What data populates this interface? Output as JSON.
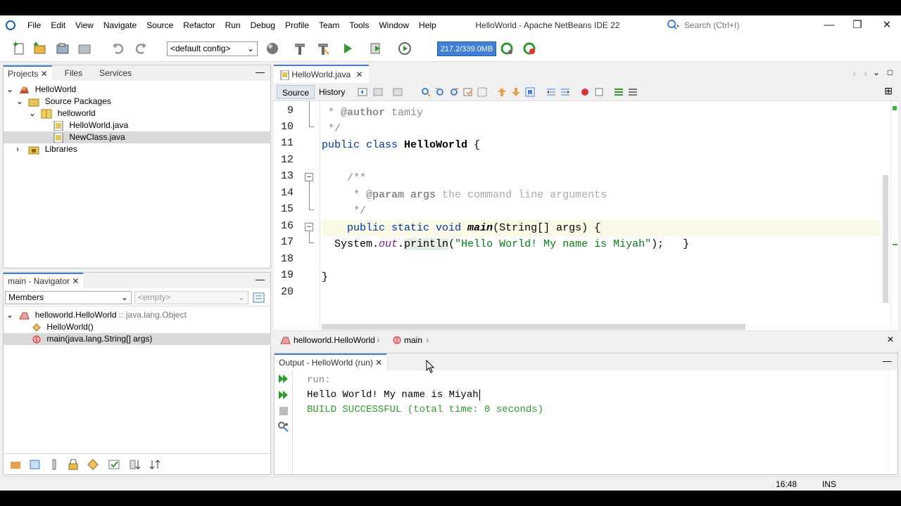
{
  "window": {
    "title": "HelloWorld - Apache NetBeans IDE 22"
  },
  "menu": [
    "File",
    "Edit",
    "View",
    "Navigate",
    "Source",
    "Refactor",
    "Run",
    "Debug",
    "Profile",
    "Team",
    "Tools",
    "Window",
    "Help"
  ],
  "search": {
    "placeholder": "Search (Ctrl+I)"
  },
  "toolbar": {
    "config": "<default config>",
    "memory": "217.2/339.0MB"
  },
  "projects": {
    "tabs": [
      "Projects",
      "Files",
      "Services"
    ],
    "tree": [
      {
        "label": "HelloWorld"
      },
      {
        "label": "Source Packages"
      },
      {
        "label": "helloworld"
      },
      {
        "label": "HelloWorld.java"
      },
      {
        "label": "NewClass.java"
      },
      {
        "label": "Libraries"
      }
    ]
  },
  "navigator": {
    "title": "main - Navigator",
    "filter": "Members",
    "filter2": "<empty>",
    "items": [
      {
        "label": "helloworld.HelloWorld",
        "suffix": ":: java.lang.Object"
      },
      {
        "label": "HelloWorld()"
      },
      {
        "label": "main(java.lang.String[] args)"
      }
    ]
  },
  "editor": {
    "tab": "HelloWorld.java",
    "modes": [
      "Source",
      "History"
    ],
    "lines": [
      {
        "n": "9"
      },
      {
        "n": "10"
      },
      {
        "n": "11"
      },
      {
        "n": "12"
      },
      {
        "n": "13"
      },
      {
        "n": "14"
      },
      {
        "n": "15"
      },
      {
        "n": "16"
      },
      {
        "n": "17"
      },
      {
        "n": "18"
      },
      {
        "n": "19"
      },
      {
        "n": "20"
      }
    ],
    "code": {
      "l9a": " * ",
      "l9b": "@author",
      "l9c": " tamiy",
      "l10": " */",
      "l11a": "public class ",
      "l11b": "HelloWorld",
      "l11c": " {",
      "l13": "    /**",
      "l14a": "     * ",
      "l14b": "@param",
      "l14c": " args",
      "l14d": " the command line arguments",
      "l15": "     */",
      "l16a": "    public static void ",
      "l16b": "main",
      "l16c": "(String[] args) {",
      "l17a": "  System.",
      "l17b": "out",
      "l17c": ".",
      "l17d": "println",
      "l17e": "(",
      "l17f": "\"Hello World! My name is Miyah\"",
      "l17g": ");   }",
      "l19": "}"
    },
    "breadcrumb": [
      "helloworld.HelloWorld",
      "main"
    ]
  },
  "output": {
    "tab": "Output - HelloWorld (run)",
    "lines": [
      "run:",
      "Hello World! My name is Miyah",
      "BUILD SUCCESSFUL (total time: 0 seconds)"
    ]
  },
  "status": {
    "position": "16:48",
    "mode": "INS"
  },
  "colors": {
    "accent": "#3f7fd6",
    "keyword": "#0033b3",
    "string": "#067d17",
    "comment": "#8c8c8c",
    "build_ok": "#2e9a2e"
  }
}
